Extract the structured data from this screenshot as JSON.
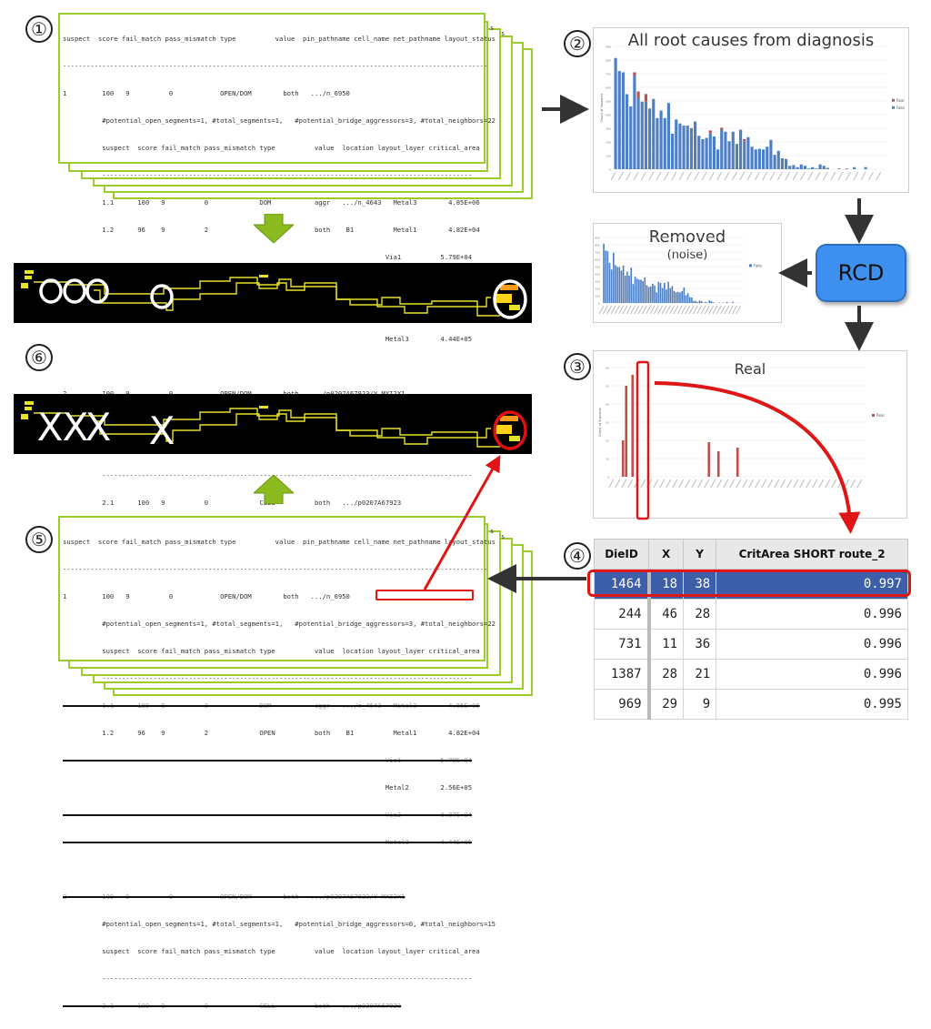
{
  "steps": [
    "①",
    "②",
    "③",
    "④",
    "⑤",
    "⑥"
  ],
  "report": {
    "header": "suspect  score fail_match pass_mismatch type          value  pin_pathname cell_name net_pathname layout_status",
    "divider": "------------------------------------------------------------------------------------------------------------",
    "s1_line": "1         100   9          0            OPEN/DOM        both   .../n_6950",
    "s1_meta": "          #potential_open_segments=1, #total_segments=1,   #potential_bridge_aggressors=3, #total_neighbors=22",
    "sub_header": "          suspect  score fail_match pass_mismatch type          value  location layout_layer critical_area",
    "sub_divider": "          ----------------------------------------------------------------------------------------------",
    "s1_rows": [
      "          1.1      100   9          0             DOM           aggr   .../n_4643   Metal3        4.85E+06",
      "          1.2      96    9          2             OPEN          both    B1          Metal1        4.82E+04",
      "                                                                                  Via1          5.79E+04",
      "                                                                                  Metal2        2.56E+05",
      "                                                                                  Via2          9.87E+04",
      "                                                                                  Metal3        4.44E+05"
    ],
    "s2_line": "2         100   9          0            OPEN/DOM        both   .../p0207A67923/Y MXI2X1",
    "s2_meta": "          #potential_open_segments=1, #total_segments=1,   #potential_bridge_aggressors=0, #total_neighbors=15",
    "s2_rows": [
      "          2.1      100   9          0             CELL          both   .../p0207A67923"
    ],
    "edge_char": "s",
    "highlight": {
      "layer": "Metal2",
      "value": "2.56E+05"
    }
  },
  "layout": {
    "markers_top": [
      "○",
      "○",
      "○",
      "○",
      "○"
    ],
    "markers_bottom": [
      "X",
      "X",
      "X",
      "X"
    ],
    "colors": {
      "background": "#000000",
      "wire": "#e6e22a",
      "circle": "#ffffff",
      "highlight": "#e01010"
    }
  },
  "rcd_label": "RCD",
  "arrows": {
    "green": "#8bbb1e",
    "dark": "#333333",
    "red": "#e01515"
  },
  "chart_data": [
    {
      "id": "all-root-causes",
      "type": "bar",
      "stacked": true,
      "title": "All root causes from diagnosis",
      "subtitle": "",
      "xlabel": "",
      "ylabel": "Count of Suspects",
      "ylim": [
        0,
        900
      ],
      "yticks": [
        0,
        100,
        200,
        300,
        400,
        500,
        600,
        700,
        800,
        900
      ],
      "grid": true,
      "legend": [
        "Real",
        "Fake"
      ],
      "legend_position": "right",
      "series": [
        {
          "name": "Fake",
          "color": "#4e7fc4",
          "values": [
            815,
            720,
            710,
            550,
            460,
            690,
            520,
            495,
            495,
            445,
            515,
            375,
            430,
            375,
            485,
            260,
            365,
            335,
            320,
            320,
            300,
            350,
            245,
            220,
            230,
            265,
            240,
            145,
            290,
            275,
            205,
            275,
            185,
            290,
            205,
            235,
            165,
            145,
            150,
            145,
            165,
            215,
            105,
            135,
            80,
            75,
            25,
            30,
            15,
            35,
            25,
            5,
            15,
            5,
            35,
            25,
            10,
            0,
            0,
            5,
            0,
            5,
            0,
            15,
            0,
            0,
            15,
            0,
            0,
            0,
            0,
            0
          ]
        },
        {
          "name": "Real",
          "color": "#c0504d",
          "values": [
            0,
            0,
            0,
            0,
            0,
            20,
            50,
            0,
            56,
            0,
            0,
            0,
            0,
            0,
            0,
            0,
            0,
            0,
            0,
            0,
            0,
            0,
            0,
            0,
            0,
            19,
            0,
            0,
            14,
            0,
            0,
            0,
            0,
            0,
            16,
            0,
            0,
            0,
            0,
            0,
            0,
            0,
            0,
            0,
            0,
            0,
            0,
            0,
            0,
            0,
            0,
            0,
            0,
            0,
            0,
            0,
            0,
            0,
            0,
            0,
            0,
            0,
            0,
            0,
            0,
            0,
            0,
            0,
            0,
            0,
            0,
            0
          ]
        }
      ]
    },
    {
      "id": "removed-noise",
      "type": "bar",
      "title": "Removed",
      "subtitle": "(noise)",
      "ylabel": "Count of Suspects",
      "ylim": [
        0,
        900
      ],
      "yticks": [
        0,
        100,
        200,
        300,
        400,
        500,
        600,
        700,
        800,
        900
      ],
      "grid": true,
      "legend": [
        "Fake"
      ],
      "legend_position": "right",
      "series": [
        {
          "name": "Fake",
          "color": "#4e7fc4",
          "values": [
            815,
            720,
            710,
            550,
            460,
            690,
            520,
            495,
            495,
            445,
            515,
            375,
            430,
            375,
            485,
            260,
            365,
            335,
            320,
            320,
            300,
            350,
            245,
            220,
            230,
            265,
            240,
            145,
            290,
            275,
            205,
            275,
            185,
            290,
            205,
            235,
            165,
            145,
            150,
            145,
            165,
            215,
            105,
            135,
            80,
            75,
            25,
            30,
            15,
            35,
            25,
            5,
            15,
            5,
            35,
            25,
            10,
            0,
            0,
            5,
            0,
            5,
            0,
            15,
            0,
            0,
            15,
            0,
            0,
            0,
            0,
            0
          ]
        }
      ]
    },
    {
      "id": "real",
      "type": "bar",
      "title": "Real",
      "ylabel": "Count of Suspects",
      "ylim": [
        0,
        60
      ],
      "yticks": [
        0,
        10,
        20,
        30,
        40,
        50,
        60
      ],
      "grid": true,
      "legend": [
        "Real"
      ],
      "legend_position": "right",
      "highlight_index": 3,
      "series": [
        {
          "name": "Real",
          "color": "#c0504d",
          "values": [
            0,
            0,
            0,
            20,
            50,
            0,
            56,
            0,
            0,
            0,
            0,
            0,
            0,
            0,
            0,
            0,
            0,
            0,
            0,
            0,
            0,
            0,
            0,
            0,
            0,
            0,
            0,
            0,
            0,
            0,
            19,
            0,
            0,
            14,
            0,
            0,
            0,
            0,
            0,
            16,
            0,
            0,
            0,
            0,
            0,
            0,
            0,
            0,
            0,
            0,
            0,
            0,
            0,
            0,
            0,
            0,
            0,
            0,
            0,
            0,
            0,
            0,
            0,
            0,
            0,
            0,
            0,
            0,
            0,
            0,
            0,
            0,
            0,
            0,
            0,
            0,
            0,
            0,
            0,
            0
          ]
        }
      ]
    }
  ],
  "table": {
    "columns": [
      "DieID",
      "X",
      "Y",
      "CritArea SHORT route_2"
    ],
    "rows": [
      [
        "1464",
        "18",
        "38",
        "0.997"
      ],
      [
        "244",
        "46",
        "28",
        "0.996"
      ],
      [
        "731",
        "11",
        "36",
        "0.996"
      ],
      [
        "1387",
        "28",
        "21",
        "0.996"
      ],
      [
        "969",
        "29",
        "9",
        "0.995"
      ]
    ],
    "selected_row": 0
  }
}
